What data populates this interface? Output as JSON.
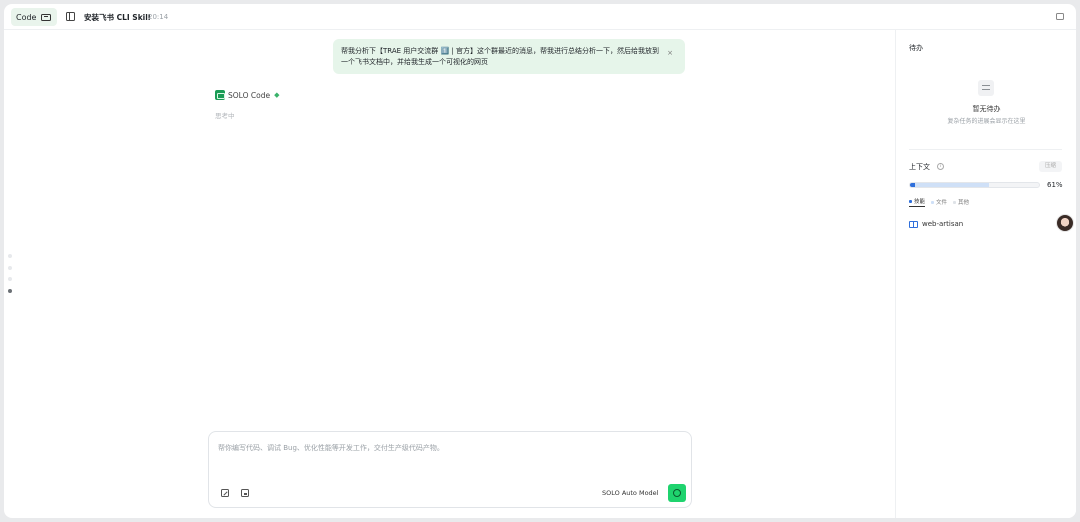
{
  "topbar": {
    "mode_label": "Code",
    "mode_icon": "terminal-icon",
    "sidebar_toggle_icon": "sidebar-icon",
    "task_title": "安装飞书 CLI Skill",
    "task_time": "20:14",
    "panel_toggle_icon": "panel-toggle-icon"
  },
  "chat": {
    "user_message": "帮我分析下【TRAE 用户交流群 1️⃣ | 官方】这个群最近的消息，帮我进行总结分析一下，然后给我放到一个飞书文档中，并给我生成一个可视化的网页",
    "user_message_close": "×",
    "assistant_name": "SOLO Code",
    "assistant_status": "思考中"
  },
  "composer": {
    "placeholder": "帮你编写代码、调试 Bug、优化性能等开发工作，交付生产级代码产物。",
    "model_label": "SOLO Auto Model",
    "send_icon": "send-icon",
    "accent": "#1fd36e"
  },
  "right_panel": {
    "todo_title": "待办",
    "todo_empty": "暂无待办",
    "todo_empty_sub": "复杂任务的进展会显示在这里",
    "context_title": "上下文",
    "compress_label": "压缩",
    "context_percent": "61%",
    "context_used_fraction": 0.61,
    "legend": [
      {
        "label": "技能",
        "color": "#2f6fdb"
      },
      {
        "label": "文件",
        "color": "#cfe0f7"
      },
      {
        "label": "其他",
        "color": "#dfe3e8"
      }
    ],
    "skill_name": "web-artisan"
  }
}
